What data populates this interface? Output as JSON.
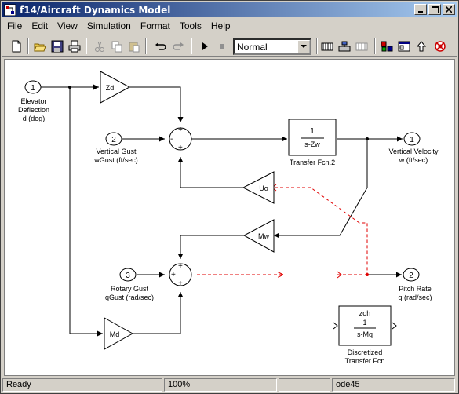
{
  "window": {
    "title": "f14/Aircraft Dynamics Model"
  },
  "menu": [
    "File",
    "Edit",
    "View",
    "Simulation",
    "Format",
    "Tools",
    "Help"
  ],
  "toolbar": {
    "mode_value": "Normal",
    "icons": [
      "new-icon",
      "open-icon",
      "save-icon",
      "print-icon",
      "cut-icon",
      "copy-icon",
      "paste-icon",
      "undo-icon",
      "redo-icon",
      "play-icon",
      "stop-icon",
      "build-icon",
      "update-icon",
      "blocks-icon",
      "library-icon",
      "explorer-icon",
      "up-icon",
      "debug-icon"
    ]
  },
  "diagram": {
    "ports": {
      "in1": "1",
      "in2": "2",
      "in3": "3",
      "out1": "1",
      "out2": "2"
    },
    "labels": {
      "elevator": [
        "Elevator",
        "Deflection",
        "d (deg)"
      ],
      "vgust": [
        "Vertical Gust",
        "wGust (ft/sec)"
      ],
      "rgust": [
        "Rotary Gust",
        "qGust (rad/sec)"
      ],
      "vvel": [
        "Vertical Velocity",
        "w (ft/sec)"
      ],
      "pitch": [
        "Pitch Rate",
        "q (rad/sec)"
      ],
      "tf2": "Transfer Fcn.2",
      "dtf": [
        "Discretized",
        "Transfer Fcn"
      ]
    },
    "gains": {
      "zd": "Zd",
      "uo": "Uo",
      "mw": "Mw",
      "md": "Md"
    },
    "tf": {
      "num": "1",
      "den": "s-Zw"
    },
    "dtf": {
      "zoh": "zoh",
      "num": "1",
      "den": "s-Mq"
    },
    "signs": {
      "plus": "+",
      "minus": "-"
    }
  },
  "status": {
    "state": "Ready",
    "zoom": "100%",
    "solver": "ode45"
  }
}
